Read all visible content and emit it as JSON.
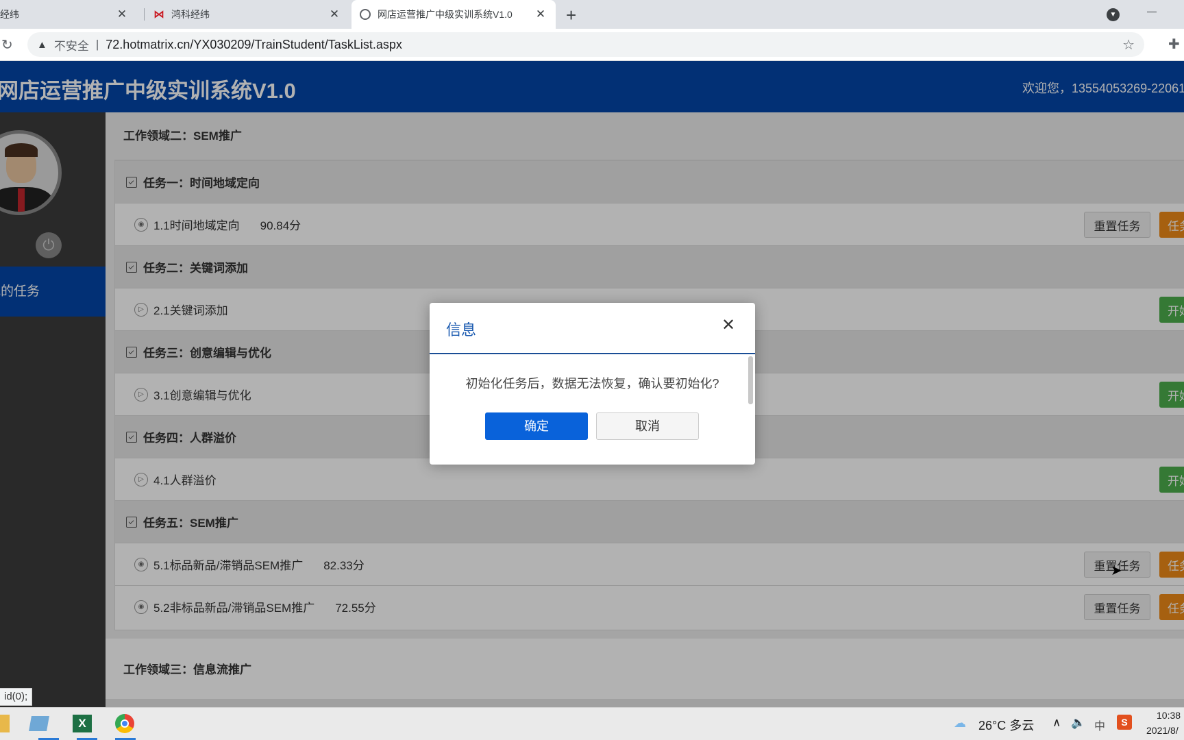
{
  "browser": {
    "tabs": [
      {
        "title": "经纬"
      },
      {
        "title": "鸿科经纬"
      },
      {
        "title": "网店运营推广中级实训系统V1.0"
      }
    ],
    "security_label": "不安全",
    "url": "72.hotmatrix.cn/YX030209/TrainStudent/TaskList.aspx"
  },
  "header": {
    "title": "网店运营推广中级实训系统V1.0",
    "welcome": "欢迎您，13554053269-22061"
  },
  "sidebar": {
    "menu_item": "我的任务"
  },
  "main": {
    "area_title": "工作领域二：SEM推广",
    "groups": [
      {
        "title": "任务一：时间地域定向",
        "items": [
          {
            "name": "1.1时间地域定向",
            "score": "90.84分",
            "reset": "重置任务",
            "action": "任务"
          }
        ]
      },
      {
        "title": "任务二：关键词添加",
        "items": [
          {
            "name": "2.1关键词添加",
            "action": "开始"
          }
        ]
      },
      {
        "title": "任务三：创意编辑与优化",
        "items": [
          {
            "name": "3.1创意编辑与优化",
            "action": "开始"
          }
        ]
      },
      {
        "title": "任务四：人群溢价",
        "items": [
          {
            "name": "4.1人群溢价",
            "action": "开始"
          }
        ]
      },
      {
        "title": "任务五：SEM推广",
        "items": [
          {
            "name": "5.1标品新品/滞销品SEM推广",
            "score": "82.33分",
            "reset": "重置任务",
            "action": "任务"
          },
          {
            "name": "5.2非标品新品/滞销品SEM推广",
            "score": "72.55分",
            "reset": "重置任务",
            "action": "任务"
          }
        ]
      }
    ],
    "area3_title": "工作领域三：信息流推广"
  },
  "dialog": {
    "title": "信息",
    "message": "初始化任务后，数据无法恢复，确认要初始化?",
    "confirm": "确定",
    "cancel": "取消"
  },
  "status_tip": "id(0);",
  "taskbar": {
    "weather": "26°C 多云",
    "ime": "中",
    "time": "10:38",
    "date": "2021/8/"
  }
}
